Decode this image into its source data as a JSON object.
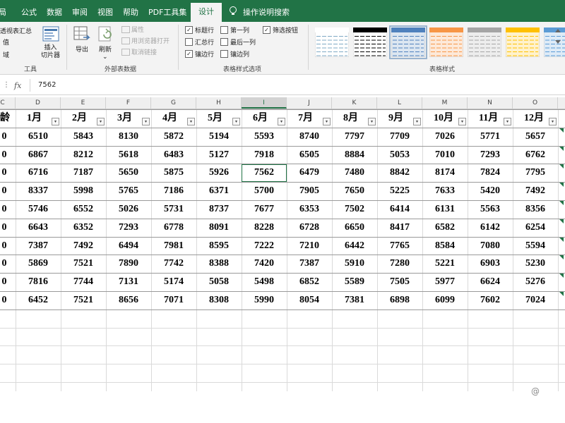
{
  "ribbon": {
    "tabs": [
      "局",
      "公式",
      "数据",
      "审阅",
      "视图",
      "帮助",
      "PDF工具集",
      "设计"
    ],
    "active_tab": "设计",
    "tell_me": "操作说明搜索",
    "tools": {
      "pivot": "透视表汇总",
      "dup": "值",
      "range": "域",
      "slicer": "插入\n切片器",
      "label": "工具"
    },
    "external": {
      "export": "导出",
      "refresh": "刷新",
      "properties": "属性",
      "open_browser": "用浏览器打开",
      "unlink": "取消链接",
      "label": "外部表数据"
    },
    "style_options": {
      "header_row": "标题行",
      "total_row": "汇总行",
      "banded_rows": "镶边行",
      "first_col": "第一列",
      "last_col": "最后一列",
      "banded_cols": "镶边列",
      "filter_btn": "筛选按钮",
      "checked": [
        "header_row",
        "banded_rows",
        "filter_btn"
      ],
      "label": "表格样式选项"
    },
    "styles_label": "表格样式",
    "styles": [
      {
        "fill": "#ffffff",
        "header": "#ffffff",
        "line": "#7fa9c4",
        "selected": false
      },
      {
        "fill": "#ffffff",
        "header": "#000000",
        "line": "#000000",
        "selected": false
      },
      {
        "fill": "#dce6f1",
        "header": "#4f81bd",
        "line": "#4f81bd",
        "selected": true
      },
      {
        "fill": "#fde9d9",
        "header": "#f79646",
        "line": "#f79646",
        "selected": false
      },
      {
        "fill": "#ededed",
        "header": "#a5a5a5",
        "line": "#a5a5a5",
        "selected": false
      },
      {
        "fill": "#fff2cc",
        "header": "#ffc000",
        "line": "#ffc000",
        "selected": false
      },
      {
        "fill": "#deebf7",
        "header": "#5b9bd5",
        "line": "#5b9bd5",
        "selected": false
      }
    ]
  },
  "formula_bar": {
    "fx": "fx",
    "value": "7562"
  },
  "columns": [
    "C",
    "D",
    "E",
    "F",
    "G",
    "H",
    "I",
    "J",
    "K",
    "L",
    "M",
    "N",
    "O"
  ],
  "selected_column": "I",
  "table": {
    "headers": [
      "龄",
      "1月",
      "2月",
      "3月",
      "4月",
      "5月",
      "6月",
      "7月",
      "8月",
      "9月",
      "10月",
      "11月",
      "12月"
    ],
    "first_col_values": [
      "0",
      "0",
      "0",
      "0",
      "0",
      "0",
      "0",
      "0",
      "0",
      "0"
    ],
    "rows": [
      [
        6510,
        5843,
        8130,
        5872,
        5194,
        5593,
        8740,
        7797,
        7709,
        7026,
        5771,
        5657
      ],
      [
        6867,
        8212,
        5618,
        6483,
        5127,
        7918,
        6505,
        8884,
        5053,
        7010,
        7293,
        6762
      ],
      [
        6716,
        7187,
        5650,
        5875,
        5926,
        7562,
        6479,
        7480,
        8842,
        8174,
        7824,
        7795
      ],
      [
        8337,
        5998,
        5765,
        7186,
        6371,
        5700,
        7905,
        7650,
        5225,
        7633,
        5420,
        7492
      ],
      [
        5746,
        6552,
        5026,
        5731,
        8737,
        7677,
        6353,
        7502,
        6414,
        6131,
        5563,
        8356
      ],
      [
        6643,
        6352,
        7293,
        6778,
        8091,
        8228,
        6728,
        6650,
        8417,
        6582,
        6142,
        6254
      ],
      [
        7387,
        7492,
        6494,
        7981,
        8595,
        7222,
        7210,
        6442,
        7765,
        8584,
        7080,
        5594
      ],
      [
        5869,
        7521,
        7890,
        7742,
        8388,
        7420,
        7387,
        5910,
        7280,
        5221,
        6903,
        5230
      ],
      [
        7816,
        7744,
        7131,
        5174,
        5058,
        5498,
        6852,
        5589,
        7505,
        5977,
        6624,
        5276
      ],
      [
        6452,
        7521,
        8656,
        7071,
        8308,
        5990,
        8054,
        7381,
        6898,
        6099,
        7602,
        7024
      ]
    ]
  },
  "watermark": "@"
}
